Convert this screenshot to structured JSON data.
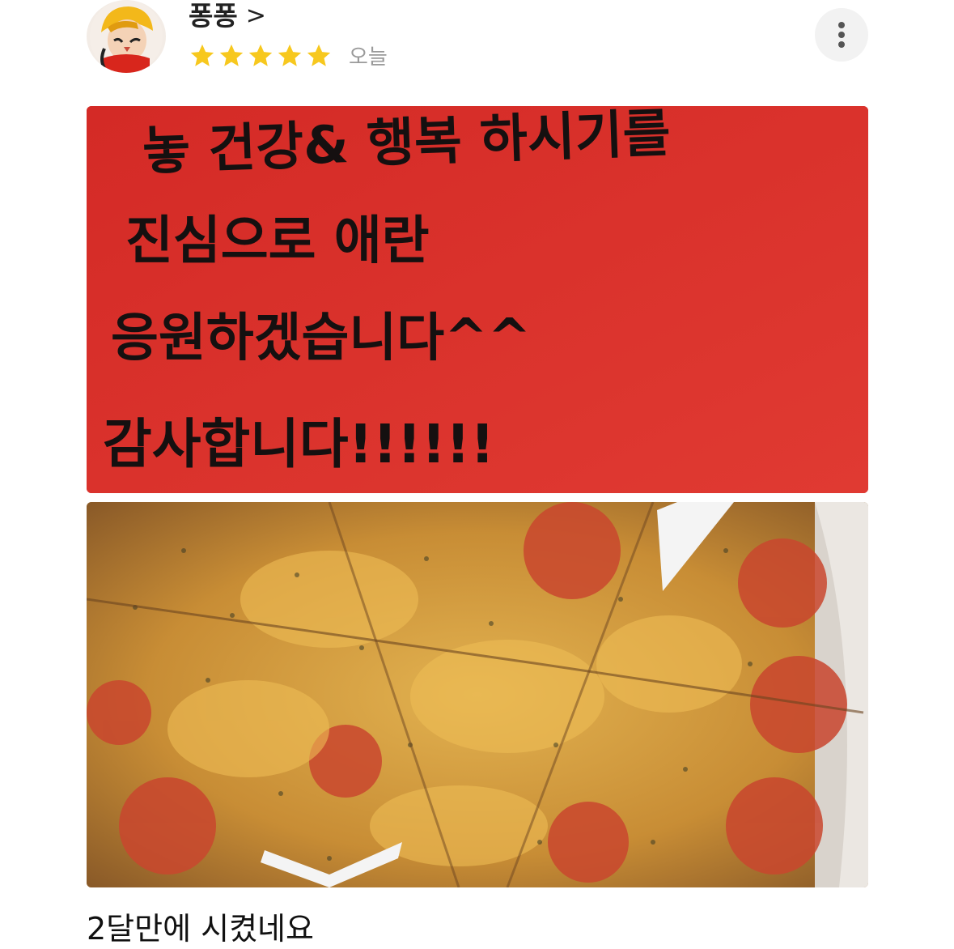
{
  "review": {
    "username": "퐁퐁",
    "chevron": ">",
    "rating": 5,
    "date": "오늘",
    "caption": "2달만에 시켰네요"
  },
  "photos": {
    "note_text": [
      "놓 건강& 행복 하시기를",
      "진심으로 애란",
      "응원하겠습니다^^",
      "감사합니다!!!!!!"
    ]
  },
  "colors": {
    "star": "#f7c81e",
    "note_background": "#d9302c"
  }
}
